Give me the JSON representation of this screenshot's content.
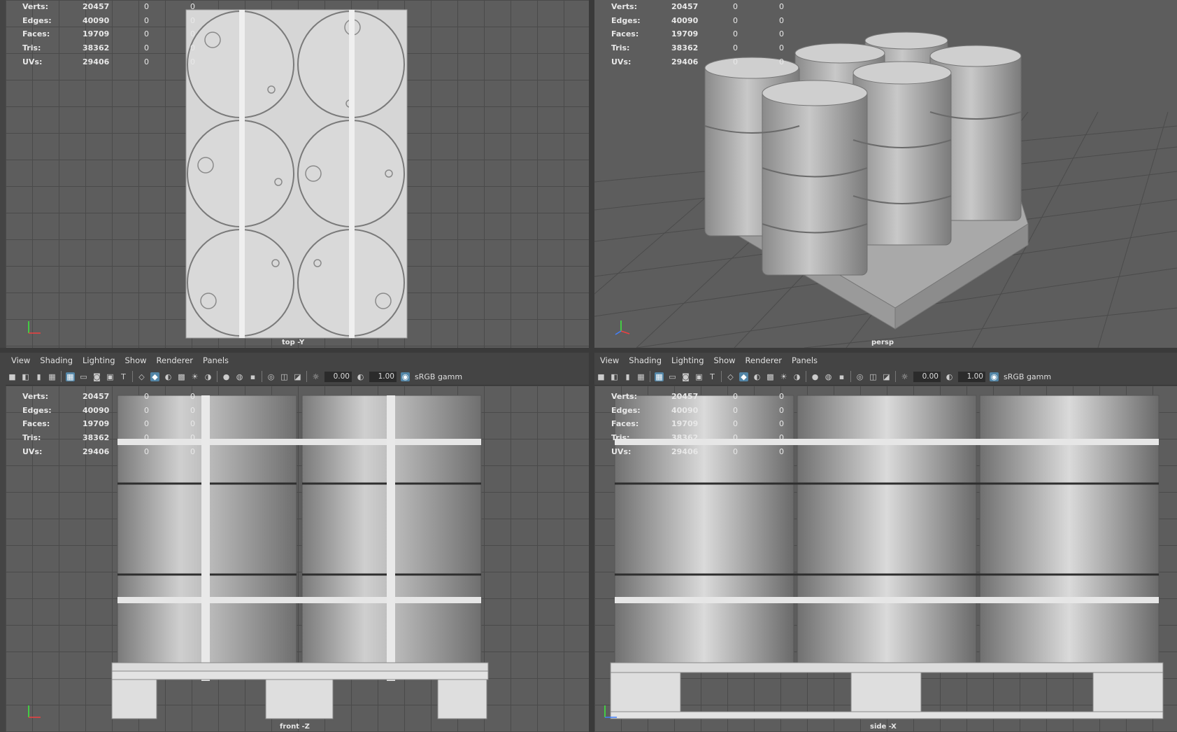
{
  "stats": {
    "rows": [
      {
        "label": "Verts:",
        "v1": "20457",
        "v2": "0",
        "v3": "0"
      },
      {
        "label": "Edges:",
        "v1": "40090",
        "v2": "0",
        "v3": "0"
      },
      {
        "label": "Faces:",
        "v1": "19709",
        "v2": "0",
        "v3": "0"
      },
      {
        "label": "Tris:",
        "v1": "38362",
        "v2": "0",
        "v3": "0"
      },
      {
        "label": "UVs:",
        "v1": "29406",
        "v2": "0",
        "v3": "0"
      }
    ]
  },
  "viewports": {
    "top": {
      "camera": "top -Y"
    },
    "persp": {
      "camera": "persp"
    },
    "front": {
      "camera": "front -Z"
    },
    "side": {
      "camera": "side -X"
    }
  },
  "menu": [
    "View",
    "Shading",
    "Lighting",
    "Show",
    "Renderer",
    "Panels"
  ],
  "toolbar": {
    "exposure": "0.00",
    "gamma": "1.00",
    "colorspace": "sRGB gamm"
  },
  "colors": {
    "viewport_bg": "#5d5d5d",
    "grid": "#4a4a4a",
    "ui_bg": "#444444",
    "active_icon": "#5285a6"
  }
}
